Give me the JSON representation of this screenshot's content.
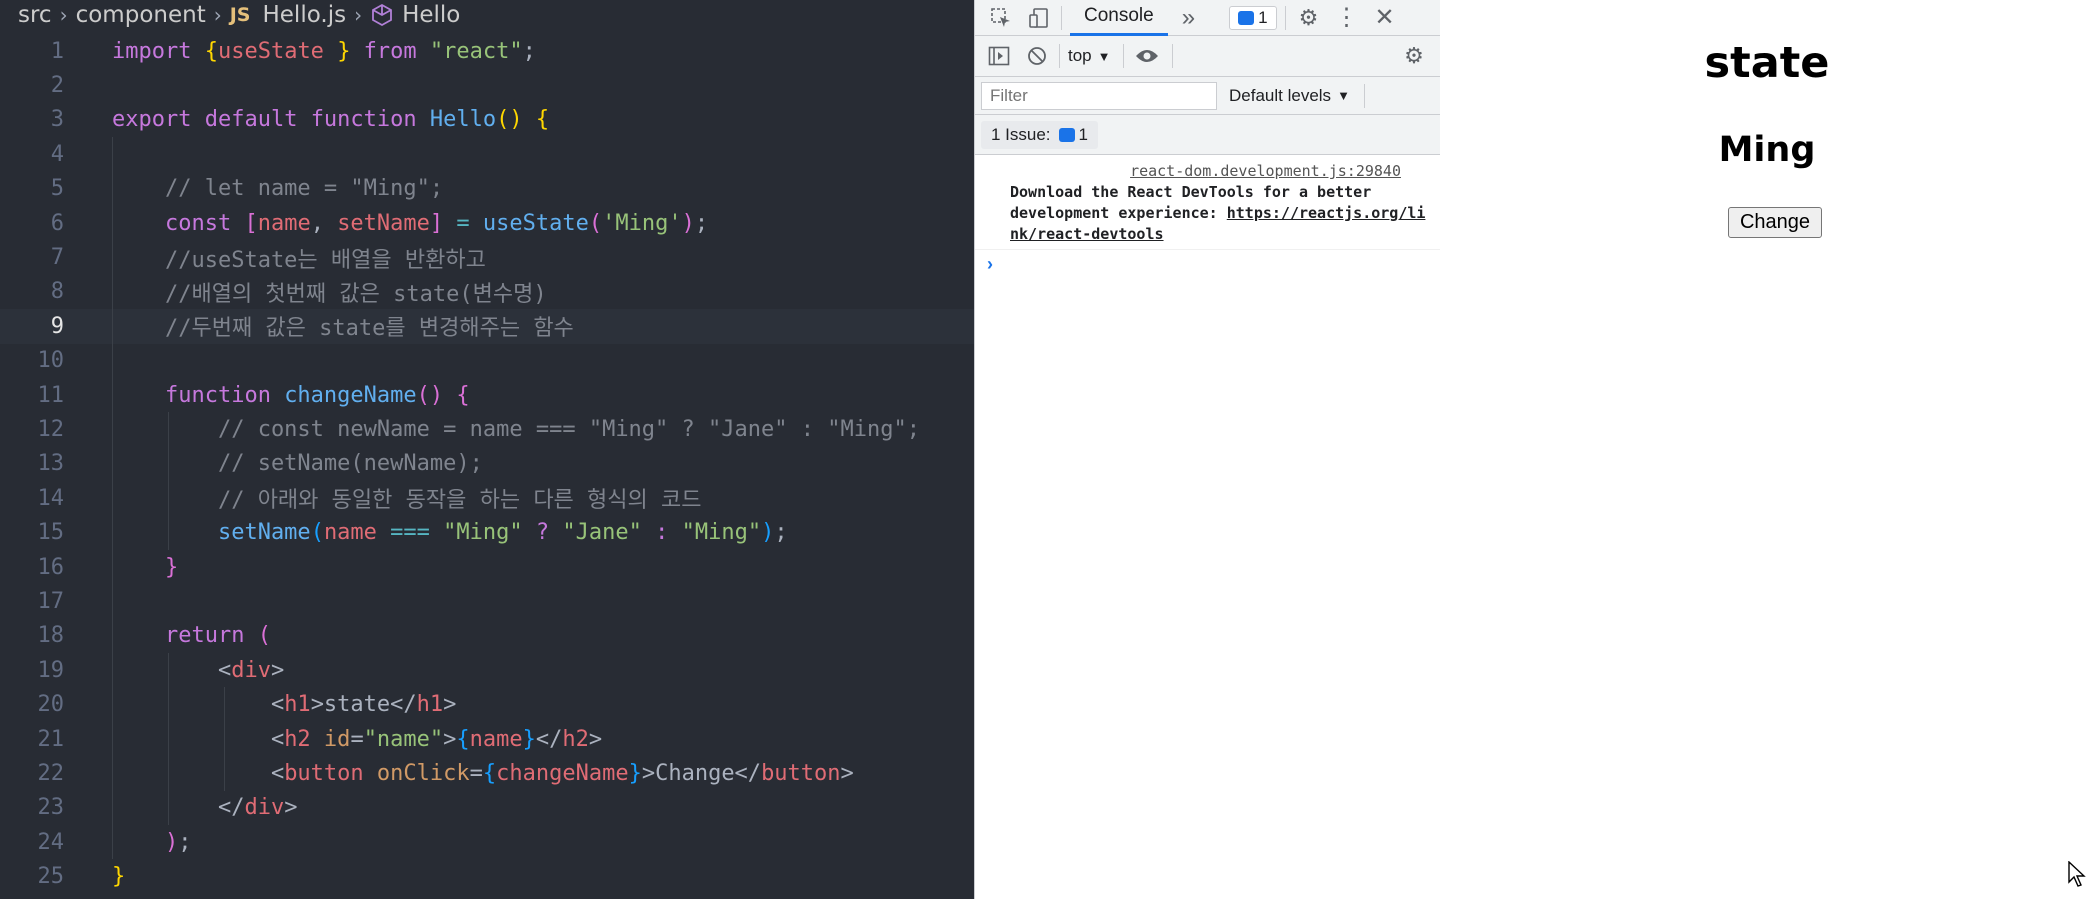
{
  "editor": {
    "breadcrumb": {
      "folder1": "src",
      "folder2": "component",
      "file_badge": "JS",
      "file": "Hello.js",
      "symbol": "Hello"
    },
    "line_numbers": [
      "1",
      "2",
      "3",
      "4",
      "5",
      "6",
      "7",
      "8",
      "9",
      "10",
      "11",
      "12",
      "13",
      "14",
      "15",
      "16",
      "17",
      "18",
      "19",
      "20",
      "21",
      "22",
      "23",
      "24",
      "25"
    ],
    "active_line": "9",
    "lines": [
      [
        {
          "t": "import ",
          "c": "kw"
        },
        {
          "t": "{",
          "c": "br1"
        },
        {
          "t": "useState ",
          "c": "var"
        },
        {
          "t": "}",
          "c": "br1"
        },
        {
          "t": " from ",
          "c": "kw"
        },
        {
          "t": "\"react\"",
          "c": "str"
        },
        {
          "t": ";",
          "c": "txt"
        }
      ],
      [],
      [
        {
          "t": "export ",
          "c": "kw"
        },
        {
          "t": "default ",
          "c": "kw"
        },
        {
          "t": "function ",
          "c": "kw"
        },
        {
          "t": "Hello",
          "c": "fn"
        },
        {
          "t": "()",
          "c": "br1"
        },
        {
          "t": " ",
          "c": "txt"
        },
        {
          "t": "{",
          "c": "br1"
        }
      ],
      [],
      [
        {
          "t": "    // let name = \"Ming\";",
          "c": "cm"
        }
      ],
      [
        {
          "t": "    const ",
          "c": "kw"
        },
        {
          "t": "[",
          "c": "br2"
        },
        {
          "t": "name",
          "c": "var"
        },
        {
          "t": ", ",
          "c": "txt"
        },
        {
          "t": "setName",
          "c": "var"
        },
        {
          "t": "]",
          "c": "br2"
        },
        {
          "t": " = ",
          "c": "op"
        },
        {
          "t": "useState",
          "c": "fn"
        },
        {
          "t": "(",
          "c": "br2"
        },
        {
          "t": "'Ming'",
          "c": "str"
        },
        {
          "t": ")",
          "c": "br2"
        },
        {
          "t": ";",
          "c": "txt"
        }
      ],
      [
        {
          "t": "    //useState는 배열을 반환하고",
          "c": "cm"
        }
      ],
      [
        {
          "t": "    //배열의 첫번째 값은 state(변수명)",
          "c": "cm"
        }
      ],
      [
        {
          "t": "    //두번째 값은 state를 변경해주는 함수",
          "c": "cm"
        }
      ],
      [],
      [
        {
          "t": "    function ",
          "c": "kw"
        },
        {
          "t": "changeName",
          "c": "fn"
        },
        {
          "t": "()",
          "c": "br2"
        },
        {
          "t": " ",
          "c": "txt"
        },
        {
          "t": "{",
          "c": "br2"
        }
      ],
      [
        {
          "t": "        // const newName = name === \"Ming\" ? \"Jane\" : \"Ming\";",
          "c": "cm"
        }
      ],
      [
        {
          "t": "        // setName(newName);",
          "c": "cm"
        }
      ],
      [
        {
          "t": "        // 아래와 동일한 동작을 하는 다른 형식의 코드",
          "c": "cm"
        }
      ],
      [
        {
          "t": "        setName",
          "c": "fn"
        },
        {
          "t": "(",
          "c": "br3"
        },
        {
          "t": "name",
          "c": "var"
        },
        {
          "t": " === ",
          "c": "op"
        },
        {
          "t": "\"Ming\"",
          "c": "str"
        },
        {
          "t": " ? ",
          "c": "kw"
        },
        {
          "t": "\"Jane\"",
          "c": "str"
        },
        {
          "t": " : ",
          "c": "kw"
        },
        {
          "t": "\"Ming\"",
          "c": "str"
        },
        {
          "t": ")",
          "c": "br3"
        },
        {
          "t": ";",
          "c": "txt"
        }
      ],
      [
        {
          "t": "    }",
          "c": "br2"
        }
      ],
      [],
      [
        {
          "t": "    return ",
          "c": "kw"
        },
        {
          "t": "(",
          "c": "br2"
        }
      ],
      [
        {
          "t": "        <",
          "c": "txt"
        },
        {
          "t": "div",
          "c": "tag"
        },
        {
          "t": ">",
          "c": "txt"
        }
      ],
      [
        {
          "t": "            <",
          "c": "txt"
        },
        {
          "t": "h1",
          "c": "tag"
        },
        {
          "t": ">state</",
          "c": "txt"
        },
        {
          "t": "h1",
          "c": "tag"
        },
        {
          "t": ">",
          "c": "txt"
        }
      ],
      [
        {
          "t": "            <",
          "c": "txt"
        },
        {
          "t": "h2",
          "c": "tag"
        },
        {
          "t": " id",
          "c": "attr"
        },
        {
          "t": "=",
          "c": "txt"
        },
        {
          "t": "\"name\"",
          "c": "str"
        },
        {
          "t": ">",
          "c": "txt"
        },
        {
          "t": "{",
          "c": "br3"
        },
        {
          "t": "name",
          "c": "var"
        },
        {
          "t": "}",
          "c": "br3"
        },
        {
          "t": "</",
          "c": "txt"
        },
        {
          "t": "h2",
          "c": "tag"
        },
        {
          "t": ">",
          "c": "txt"
        }
      ],
      [
        {
          "t": "            <",
          "c": "txt"
        },
        {
          "t": "button",
          "c": "tag"
        },
        {
          "t": " onClick",
          "c": "attr"
        },
        {
          "t": "=",
          "c": "txt"
        },
        {
          "t": "{",
          "c": "br3"
        },
        {
          "t": "changeName",
          "c": "var"
        },
        {
          "t": "}",
          "c": "br3"
        },
        {
          "t": ">Change</",
          "c": "txt"
        },
        {
          "t": "button",
          "c": "tag"
        },
        {
          "t": ">",
          "c": "txt"
        }
      ],
      [
        {
          "t": "        </",
          "c": "txt"
        },
        {
          "t": "div",
          "c": "tag"
        },
        {
          "t": ">",
          "c": "txt"
        }
      ],
      [
        {
          "t": "    )",
          "c": "br2"
        },
        {
          "t": ";",
          "c": "txt"
        }
      ],
      [
        {
          "t": "}",
          "c": "br1"
        }
      ]
    ]
  },
  "devtools": {
    "tab_console": "Console",
    "message_count": "1",
    "context": "top",
    "filter_placeholder": "Filter",
    "levels": "Default levels",
    "issues_label": "1 Issue:",
    "issues_count": "1",
    "console": {
      "source": "react-dom.development.js:29840",
      "message": "Download the React DevTools for a better development experience: ",
      "link": "https://reactjs.org/link/react-devtools"
    }
  },
  "page": {
    "h1": "state",
    "h2": "Ming",
    "button": "Change"
  },
  "colors": {
    "editor_bg": "#282c34",
    "accent": "#1a73e8"
  },
  "icons": [
    "javascript-file-icon",
    "symbol-cube-icon",
    "inspect-element-icon",
    "device-toolbar-icon",
    "more-tabs-icon",
    "settings-gear-icon",
    "kebab-menu-icon",
    "close-icon",
    "sidebar-toggle-icon",
    "clear-console-icon",
    "eye-icon",
    "mouse-cursor-icon"
  ]
}
